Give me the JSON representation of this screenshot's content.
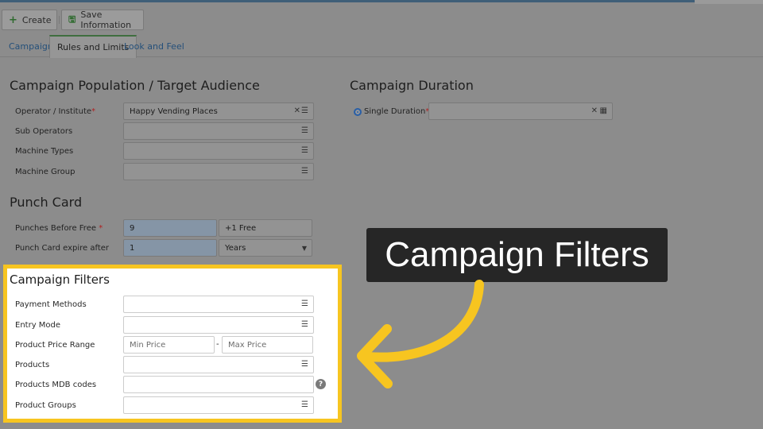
{
  "toolbar": {
    "create_label": "Create",
    "save_label": "Save Information"
  },
  "tabs": [
    {
      "label": "Campaign"
    },
    {
      "label": "Rules and Limits"
    },
    {
      "label": "Look and Feel"
    }
  ],
  "population": {
    "title": "Campaign Population / Target Audience",
    "operator_label": "Operator / Institute",
    "operator_value": "Happy Vending Places",
    "sub_operators_label": "Sub Operators",
    "machine_types_label": "Machine Types",
    "machine_group_label": "Machine Group"
  },
  "punch_card": {
    "title": "Punch Card",
    "punches_label": "Punches Before Free",
    "punches_value": "9",
    "free_value": "+1 Free",
    "expire_label": "Punch Card expire after",
    "expire_value": "1",
    "expire_unit": "Years"
  },
  "duration": {
    "title": "Campaign Duration",
    "single_label": "Single Duration"
  },
  "filters": {
    "title": "Campaign Filters",
    "payment_label": "Payment Methods",
    "entry_label": "Entry Mode",
    "price_range_label": "Product Price Range",
    "min_price_placeholder": "Min Price",
    "max_price_placeholder": "Max Price",
    "range_sep": "-",
    "products_label": "Products",
    "mdb_label": "Products MDB codes",
    "groups_label": "Product Groups"
  },
  "callout": {
    "text": "Campaign Filters"
  },
  "colors": {
    "highlight": "#f7c520",
    "arrow": "#f7c520",
    "callout_bg": "#262626"
  }
}
